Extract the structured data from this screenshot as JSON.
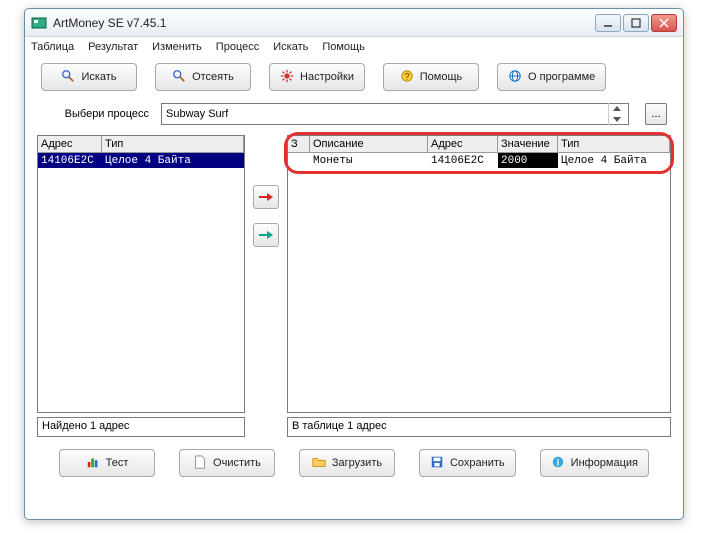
{
  "title": "ArtMoney SE v7.45.1",
  "menu": [
    "Таблица",
    "Результат",
    "Изменить",
    "Процесс",
    "Искать",
    "Помощь"
  ],
  "toolbar": {
    "search": "Искать",
    "sift": "Отсеять",
    "settings": "Настройки",
    "help": "Помощь",
    "about": "О программе"
  },
  "process": {
    "label": "Выбери процесс",
    "value": "Subway Surf",
    "browse": "..."
  },
  "leftTable": {
    "headers": [
      "Адрес",
      "Тип"
    ],
    "row": {
      "addr": "14106E2C",
      "type": "Целое 4 Байта"
    }
  },
  "rightTable": {
    "headers": {
      "num": "З",
      "desc": "Описание",
      "addr": "Адрес",
      "val": "Значение",
      "type": "Тип"
    },
    "row": {
      "num": "",
      "desc": "Монеты",
      "addr": "14106E2C",
      "val": "2000",
      "type": "Целое 4 Байта"
    }
  },
  "status": {
    "left": "Найдено 1 адрес",
    "right": "В таблице 1 адрес"
  },
  "toolbar2": {
    "test": "Тест",
    "clear": "Очистить",
    "load": "Загрузить",
    "save": "Сохранить",
    "info": "Информация"
  }
}
